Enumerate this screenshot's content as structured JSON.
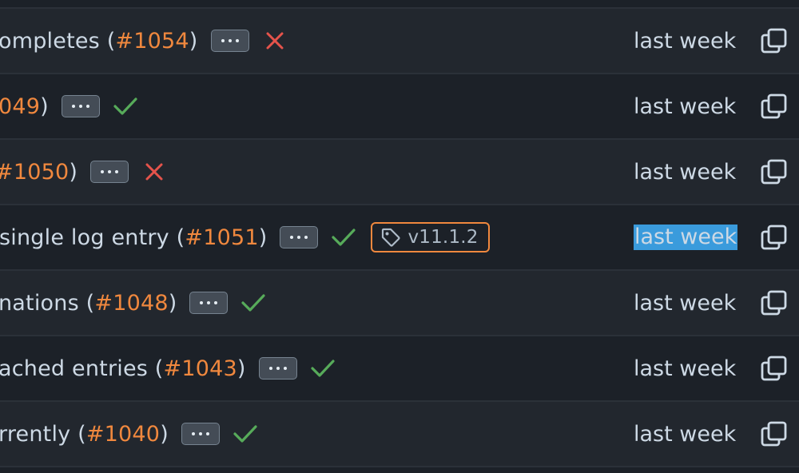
{
  "rows": [
    {
      "prefix": "ompletes (",
      "pr": "#1054",
      "suffix": ")",
      "status": "fail",
      "date": "last week",
      "tag": null
    },
    {
      "prefix": "",
      "pr": "049",
      "suffix": ")",
      "status": "success",
      "date": "last week",
      "tag": null
    },
    {
      "prefix": "",
      "pr": "#1050",
      "suffix": ")",
      "status": "fail",
      "date": "last week",
      "tag": null
    },
    {
      "prefix": "single log entry (",
      "pr": "#1051",
      "suffix": ")",
      "status": "success",
      "date": "last week",
      "tag": "v11.1.2"
    },
    {
      "prefix": "nations (",
      "pr": "#1048",
      "suffix": ")",
      "status": "success",
      "date": "last week",
      "tag": null
    },
    {
      "prefix": "ached entries (",
      "pr": "#1043",
      "suffix": ")",
      "status": "success",
      "date": "last week",
      "tag": null
    },
    {
      "prefix": "rrently (",
      "pr": "#1040",
      "suffix": ")",
      "status": "success",
      "date": "last week",
      "tag": null
    }
  ],
  "colors": {
    "fail": "#e5534b",
    "success": "#57ab5a",
    "pr_link": "#f0883e",
    "selection": "#3a9bdc"
  },
  "icons": {
    "more": "ellipsis-icon",
    "fail": "x-icon",
    "success": "check-icon",
    "tag": "tag-icon",
    "copy": "copy-icon"
  }
}
